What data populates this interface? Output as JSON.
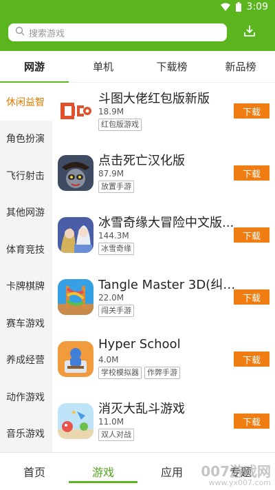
{
  "status_bar": {
    "time": "3:09"
  },
  "search": {
    "placeholder": "搜索游戏"
  },
  "tabs": [
    {
      "label": "网游",
      "active": true
    },
    {
      "label": "单机",
      "active": false
    },
    {
      "label": "下载榜",
      "active": false
    },
    {
      "label": "新品榜",
      "active": false
    }
  ],
  "sidebar": {
    "items": [
      {
        "label": "休闲益智",
        "active": true
      },
      {
        "label": "角色扮演"
      },
      {
        "label": "飞行射击"
      },
      {
        "label": "其他网游"
      },
      {
        "label": "体育竞技"
      },
      {
        "label": "卡牌棋牌"
      },
      {
        "label": "赛车游戏"
      },
      {
        "label": "养成经营"
      },
      {
        "label": "动作游戏"
      },
      {
        "label": "音乐游戏"
      }
    ]
  },
  "apps": [
    {
      "name": "斗图大佬红包版新版",
      "size": "18.9M",
      "tags": [
        "红包版游戏"
      ],
      "button": "下载",
      "icon": "doutu-icon"
    },
    {
      "name": "点击死亡汉化版",
      "size": "87.9M",
      "tags": [
        "放置手游"
      ],
      "button": "下载",
      "icon": "raccoon-pirate-icon"
    },
    {
      "name": "冰雪奇缘大冒险中文版...",
      "size": "144.3M",
      "tags": [
        "冰雪奇缘"
      ],
      "button": "下载",
      "icon": "frozen-icon"
    },
    {
      "name": "Tangle Master 3D(纠结...",
      "size": "22.0M",
      "tags": [
        "闯关手游"
      ],
      "button": "下载",
      "icon": "tangle-icon"
    },
    {
      "name": "Hyper School",
      "size": "4.0M",
      "tags": [
        "学校模拟器",
        "作弊手游"
      ],
      "button": "下载",
      "icon": "school-icon"
    },
    {
      "name": "消灭大乱斗游戏",
      "size": "11.0M",
      "tags": [
        "双人对战"
      ],
      "button": "下载",
      "icon": "brawl-icon"
    }
  ],
  "bottom_nav": [
    {
      "label": "首页",
      "active": false
    },
    {
      "label": "游戏",
      "active": true
    },
    {
      "label": "应用",
      "active": false
    },
    {
      "label": "专题",
      "active": false
    }
  ],
  "watermark": {
    "main": "007游戏网",
    "sub": "www.yx007.com"
  },
  "colors": {
    "brand": "#5bb51f",
    "download": "#ef7d12",
    "active_side": "#e07b00"
  }
}
